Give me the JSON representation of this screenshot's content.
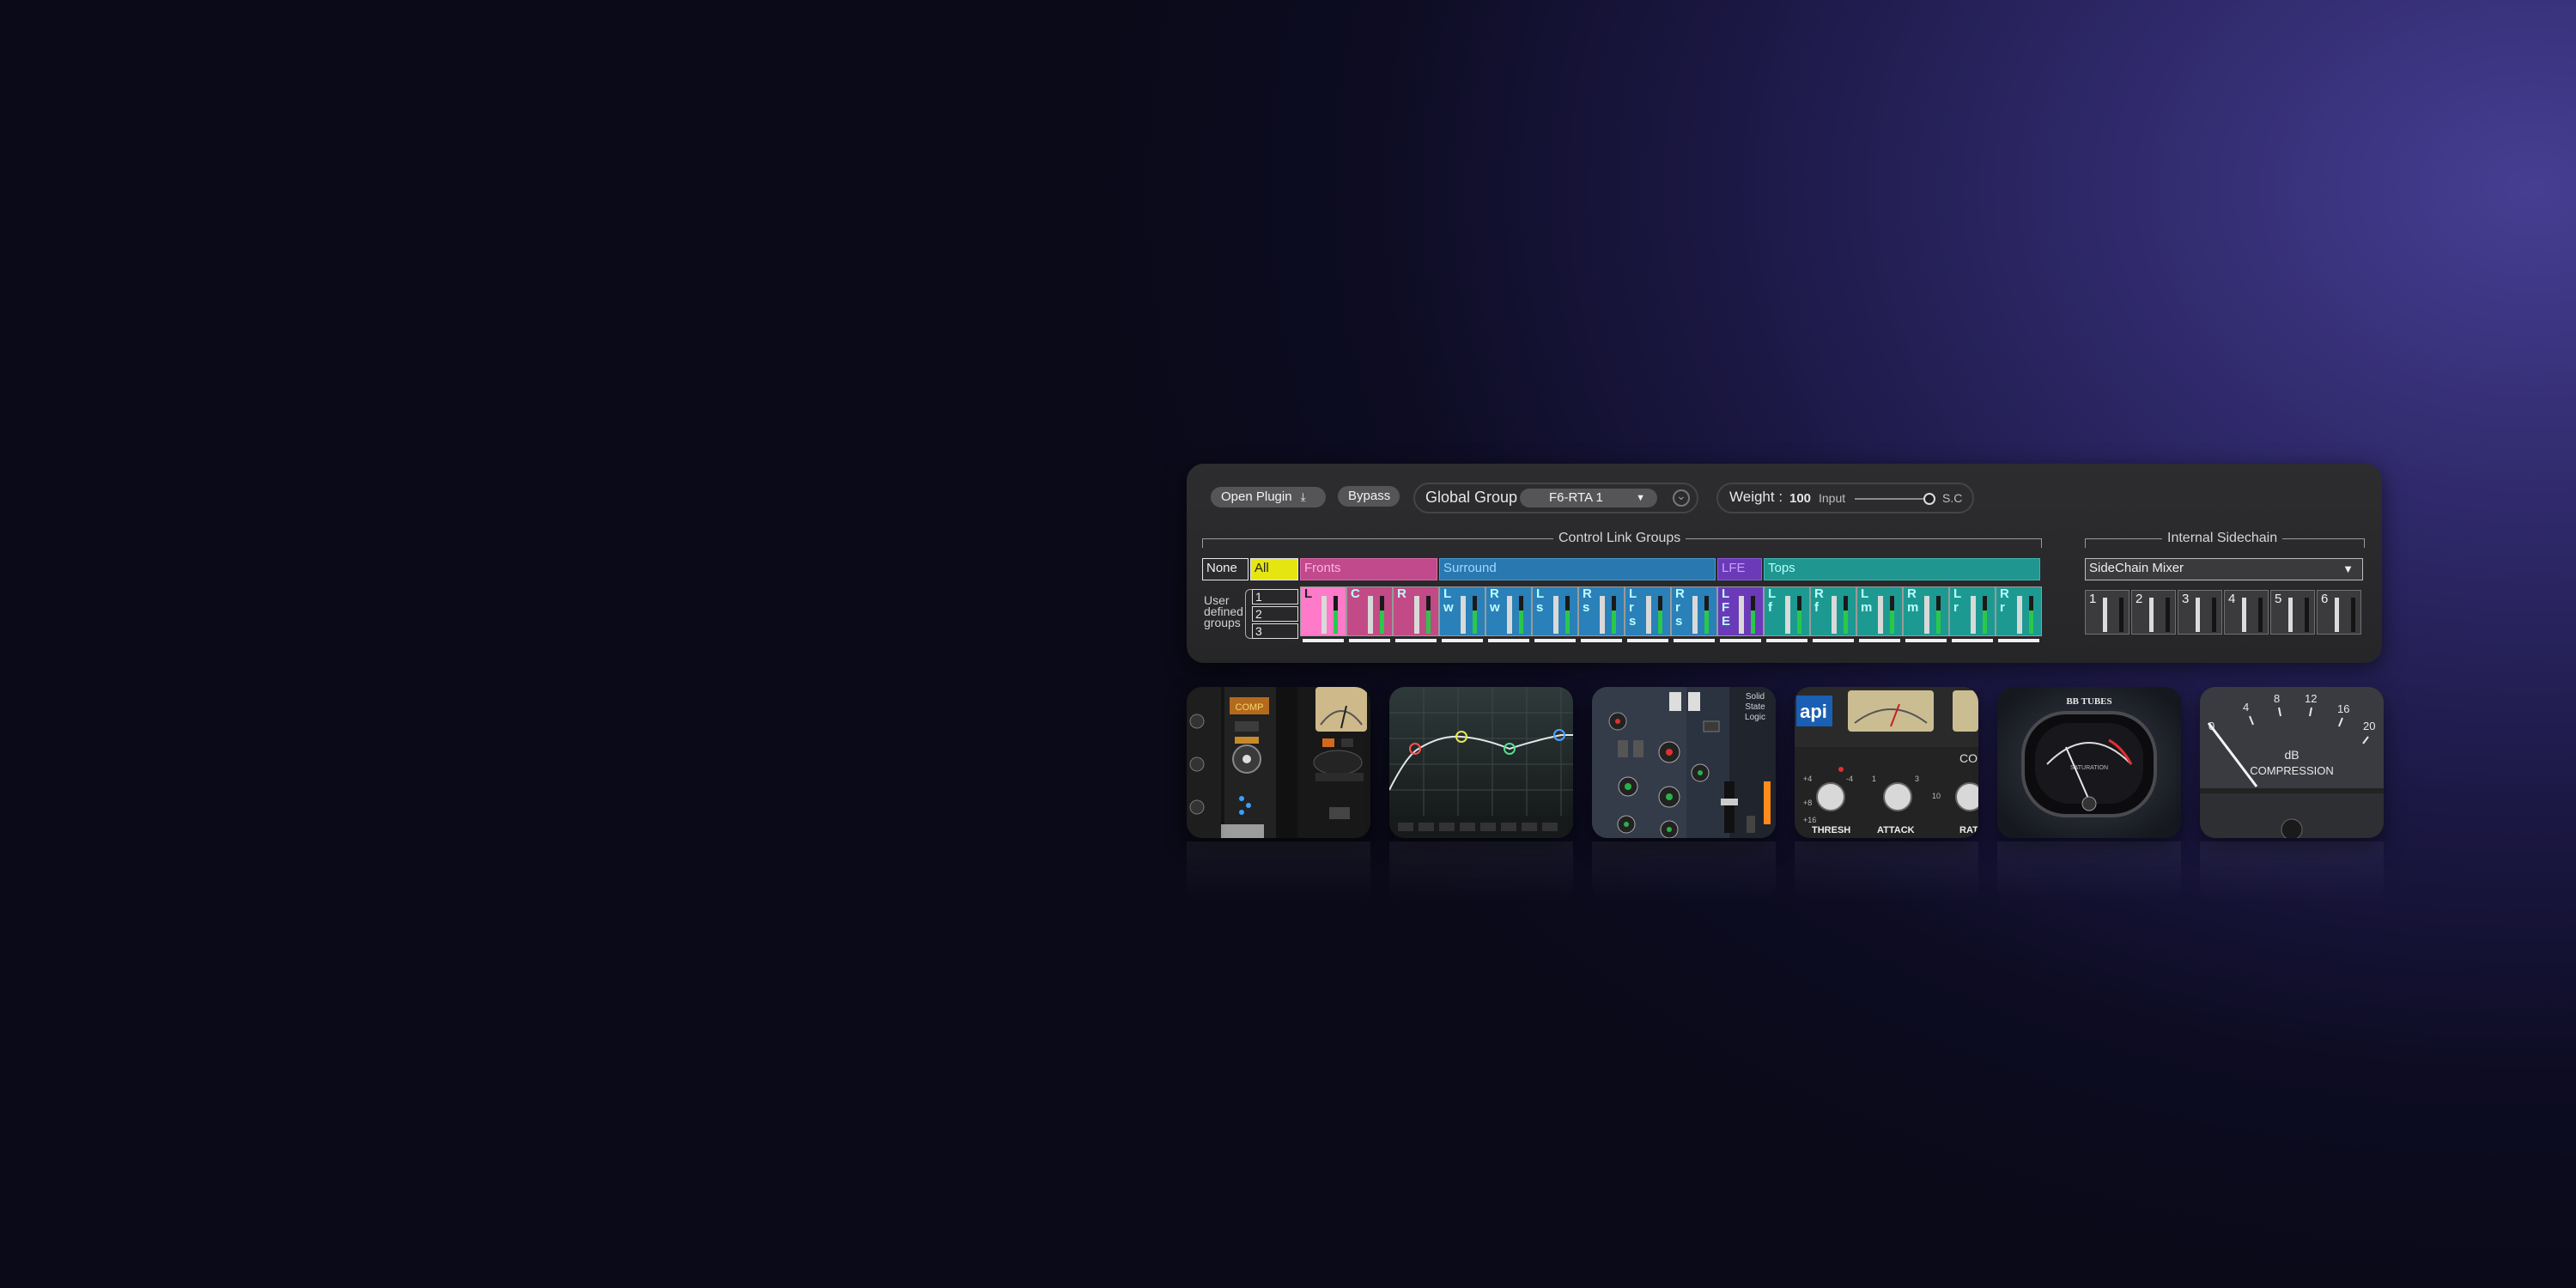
{
  "toolbar": {
    "open_plugin": "Open Plugin",
    "bypass": "Bypass",
    "global_group_label": "Global Group",
    "global_group_value": "F6-RTA 1",
    "weight_label": "Weight :",
    "weight_value": "100",
    "input_label": "Input",
    "sc_label": "S.C"
  },
  "control_link": {
    "title": "Control Link Groups",
    "groups": [
      {
        "label": "None",
        "color": "#2b2b2d"
      },
      {
        "label": "All",
        "color": "#e5e512"
      },
      {
        "label": "Fronts",
        "color": "#c04a8c"
      },
      {
        "label": "Surround",
        "color": "#2a78b0"
      },
      {
        "label": "LFE",
        "color": "#6a3ab8"
      },
      {
        "label": "Tops",
        "color": "#1f9690"
      }
    ],
    "channels": [
      {
        "label": "L",
        "color": "#ff7ac8"
      },
      {
        "label": "C",
        "color": "#c24a86"
      },
      {
        "label": "R",
        "color": "#c24a86"
      },
      {
        "label": "Lw",
        "color": "#2a80b8"
      },
      {
        "label": "Rw",
        "color": "#2a80b8"
      },
      {
        "label": "Ls",
        "color": "#2a80b8"
      },
      {
        "label": "Rs",
        "color": "#2a80b8"
      },
      {
        "label": "Lrs",
        "color": "#2a80b8"
      },
      {
        "label": "Rrs",
        "color": "#2a80b8"
      },
      {
        "label": "LFE",
        "color": "#6a3ab8"
      },
      {
        "label": "Lf",
        "color": "#1c9a92"
      },
      {
        "label": "Rf",
        "color": "#1c9a92"
      },
      {
        "label": "Lm",
        "color": "#1c9a92"
      },
      {
        "label": "Rm",
        "color": "#1c9a92"
      },
      {
        "label": "Lr",
        "color": "#1c9a92"
      },
      {
        "label": "Rr",
        "color": "#1c9a92"
      }
    ],
    "user_defined_label": "User defined groups",
    "user_groups": [
      "1",
      "2",
      "3"
    ]
  },
  "sidechain": {
    "title": "Internal Sidechain",
    "mixer_value": "SideChain Mixer",
    "channels": [
      "1",
      "2",
      "3",
      "4",
      "5",
      "6"
    ]
  },
  "plugins": [
    {
      "name": "channel-strip-plugin",
      "texts": [
        "COMP"
      ]
    },
    {
      "name": "eq-plugin",
      "texts": []
    },
    {
      "name": "ssl-plugin",
      "texts": [
        "Solid",
        "State",
        "Logic"
      ]
    },
    {
      "name": "api-plugin",
      "texts": [
        "api",
        "COMPRE",
        "THRESH",
        "ATTACK",
        "RAT"
      ]
    },
    {
      "name": "bb-tubes-plugin",
      "texts": [
        "BB TUBES",
        "SATURATION"
      ]
    },
    {
      "name": "compression-meter-plugin",
      "texts": [
        "0",
        "4",
        "8",
        "12",
        "16",
        "20",
        "dB",
        "COMPRESSION"
      ]
    }
  ]
}
